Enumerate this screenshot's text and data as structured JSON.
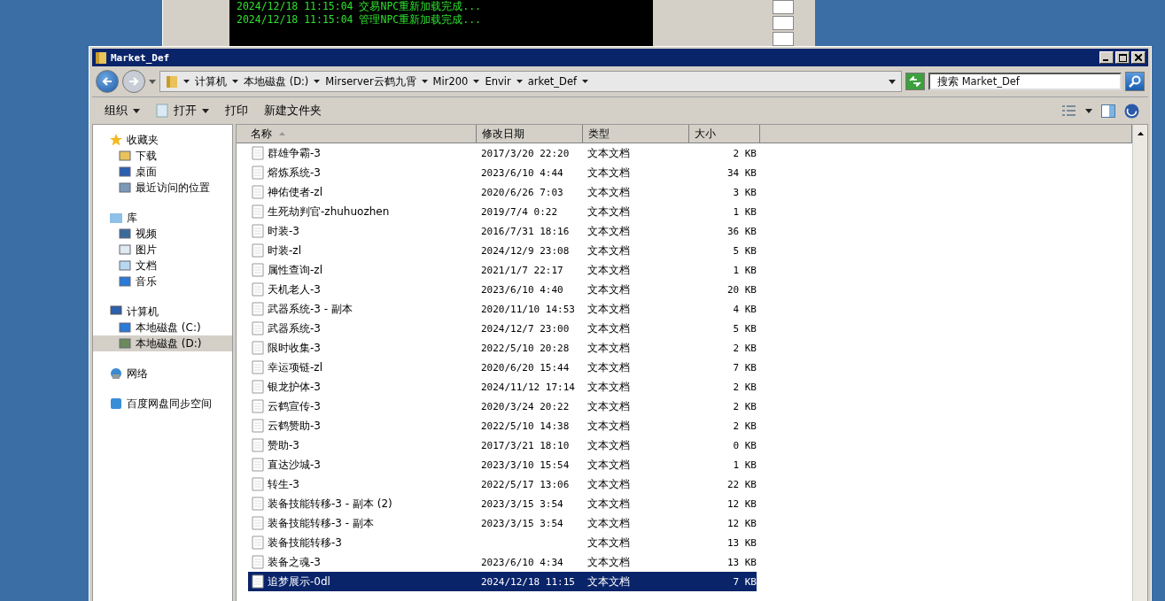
{
  "console": {
    "lines": [
      "2024/12/18 11:15:04 交易NPC重新加载完成...",
      "2024/12/18 11:15:04 管理NPC重新加载完成..."
    ]
  },
  "window": {
    "title": "Market_Def"
  },
  "breadcrumb": [
    "计算机",
    "本地磁盘 (D:)",
    "Mirserver云鹤九霄",
    "Mir200",
    "Envir",
    "arket_Def"
  ],
  "search": {
    "placeholder": "搜索 Market_Def"
  },
  "toolbar": [
    {
      "label": "组织",
      "has_menu": true
    },
    {
      "label": "打开",
      "has_menu": true
    },
    {
      "label": "打印",
      "has_menu": false
    },
    {
      "label": "新建文件夹",
      "has_menu": false
    }
  ],
  "sidebar": [
    {
      "label": "收藏夹",
      "selected": false,
      "children": [
        {
          "label": "下载",
          "selected": false
        },
        {
          "label": "桌面",
          "selected": false
        },
        {
          "label": "最近访问的位置",
          "selected": false
        }
      ]
    },
    {
      "label": "库",
      "selected": false,
      "children": [
        {
          "label": "视频",
          "selected": false
        },
        {
          "label": "图片",
          "selected": false
        },
        {
          "label": "文档",
          "selected": false
        },
        {
          "label": "音乐",
          "selected": false
        }
      ]
    },
    {
      "label": "计算机",
      "selected": false,
      "children": [
        {
          "label": "本地磁盘 (C:)",
          "selected": false
        },
        {
          "label": "本地磁盘 (D:)",
          "selected": true
        }
      ]
    },
    {
      "label": "网络",
      "selected": false
    },
    {
      "label": "百度网盘同步空间",
      "selected": false
    }
  ],
  "table": {
    "columns": [
      "名称",
      "修改日期",
      "类型",
      "大小"
    ],
    "rows": [
      {
        "name": "群雄争霸-3",
        "date": "2017/3/20 22:20",
        "type": "文本文档",
        "size": "2 KB",
        "selected": false
      },
      {
        "name": "熔炼系统-3",
        "date": "2023/6/10 4:44",
        "type": "文本文档",
        "size": "34 KB",
        "selected": false
      },
      {
        "name": "神佑使者-zl",
        "date": "2020/6/26 7:03",
        "type": "文本文档",
        "size": "3 KB",
        "selected": false
      },
      {
        "name": "生死劫判官-zhuhuozhen",
        "date": "2019/7/4 0:22",
        "type": "文本文档",
        "size": "1 KB",
        "selected": false
      },
      {
        "name": "时装-3",
        "date": "2016/7/31 18:16",
        "type": "文本文档",
        "size": "36 KB",
        "selected": false
      },
      {
        "name": "时装-zl",
        "date": "2024/12/9 23:08",
        "type": "文本文档",
        "size": "5 KB",
        "selected": false
      },
      {
        "name": "属性查询-zl",
        "date": "2021/1/7 22:17",
        "type": "文本文档",
        "size": "1 KB",
        "selected": false
      },
      {
        "name": "天机老人-3",
        "date": "2023/6/10 4:40",
        "type": "文本文档",
        "size": "20 KB",
        "selected": false
      },
      {
        "name": "武器系统-3 - 副本",
        "date": "2020/11/10 14:53",
        "type": "文本文档",
        "size": "4 KB",
        "selected": false
      },
      {
        "name": "武器系统-3",
        "date": "2024/12/7 23:00",
        "type": "文本文档",
        "size": "5 KB",
        "selected": false
      },
      {
        "name": "限时收集-3",
        "date": "2022/5/10 20:28",
        "type": "文本文档",
        "size": "2 KB",
        "selected": false
      },
      {
        "name": "幸运项链-zl",
        "date": "2020/6/20 15:44",
        "type": "文本文档",
        "size": "7 KB",
        "selected": false
      },
      {
        "name": "银龙护体-3",
        "date": "2024/11/12 17:14",
        "type": "文本文档",
        "size": "2 KB",
        "selected": false
      },
      {
        "name": "云鹤宣传-3",
        "date": "2020/3/24 20:22",
        "type": "文本文档",
        "size": "2 KB",
        "selected": false
      },
      {
        "name": "云鹤赞助-3",
        "date": "2022/5/10 14:38",
        "type": "文本文档",
        "size": "2 KB",
        "selected": false
      },
      {
        "name": "赞助-3",
        "date": "2017/3/21 18:10",
        "type": "文本文档",
        "size": "0 KB",
        "selected": false
      },
      {
        "name": "直达沙城-3",
        "date": "2023/3/10 15:54",
        "type": "文本文档",
        "size": "1 KB",
        "selected": false
      },
      {
        "name": "转生-3",
        "date": "2022/5/17 13:06",
        "type": "文本文档",
        "size": "22 KB",
        "selected": false
      },
      {
        "name": "装备技能转移-3 - 副本 (2)",
        "date": "2023/3/15 3:54",
        "type": "文本文档",
        "size": "12 KB",
        "selected": false
      },
      {
        "name": "装备技能转移-3 - 副本",
        "date": "2023/3/15 3:54",
        "type": "文本文档",
        "size": "12 KB",
        "selected": false
      },
      {
        "name": "装备技能转移-3",
        "type": "文本文档",
        "size": "13 KB",
        "selected": false
      },
      {
        "name": "装备之魂-3",
        "date": "2023/6/10 4:34",
        "type": "文本文档",
        "size": "13 KB",
        "selected": false
      },
      {
        "name": "追梦展示-0dl",
        "date": "2024/12/18 11:15",
        "type": "文本文档",
        "size": "7 KB",
        "selected": true
      }
    ]
  }
}
